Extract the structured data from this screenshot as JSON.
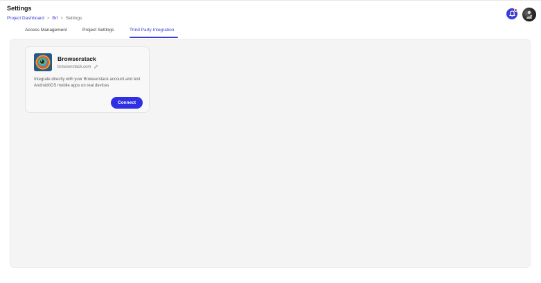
{
  "header": {
    "title": "Settings",
    "breadcrumb": [
      {
        "label": "Project Dashboard"
      },
      {
        "label": "Brl"
      },
      {
        "label": "Settings"
      }
    ],
    "separator": ">"
  },
  "tabs": [
    {
      "label": "Access Management",
      "active": false
    },
    {
      "label": "Project Settings",
      "active": false
    },
    {
      "label": "Third Party Integration",
      "active": true
    }
  ],
  "integrations": [
    {
      "name": "Browserstack",
      "url": "browserstack.com",
      "description": "Integrate directly with your Browserstack account and test Android/iOS mobile apps on real devices",
      "action_label": "Connect",
      "icon": "browserstack-logo"
    }
  ],
  "icons": {
    "notifications": "bell-icon",
    "edit": "pencil-icon"
  },
  "colors": {
    "accent": "#3b3bd9",
    "button": "#2f2fe3",
    "notification_dot": "#e2304a",
    "content_bg": "#f4f4f5"
  }
}
